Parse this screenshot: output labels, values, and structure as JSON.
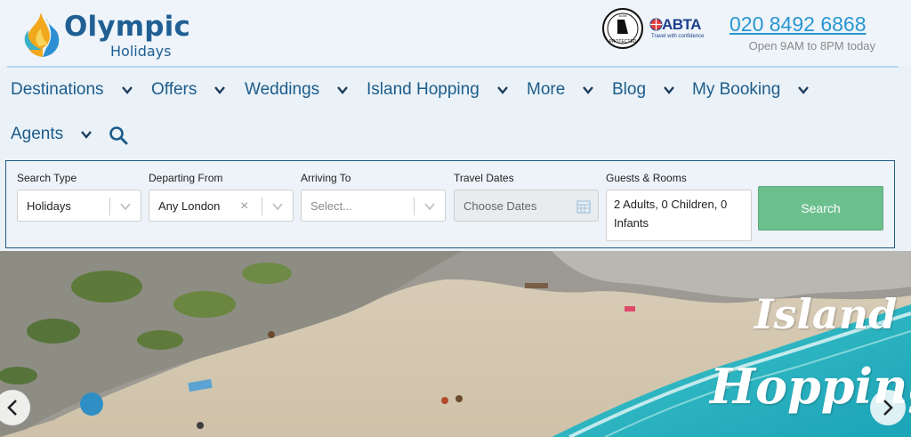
{
  "header": {
    "logo_name": "Olympic",
    "logo_sub": "Holidays",
    "atol_text": "PROTECTED",
    "atol_number": "6108",
    "abta_text": "ABTA",
    "abta_sub": "Travel with confidence",
    "phone": "020 8492 6868",
    "hours": "Open 9AM to 8PM today"
  },
  "nav": {
    "items": [
      {
        "label": "Destinations"
      },
      {
        "label": "Offers"
      },
      {
        "label": "Weddings"
      },
      {
        "label": "Island Hopping"
      },
      {
        "label": "More"
      },
      {
        "label": "Blog"
      },
      {
        "label": "My Booking"
      },
      {
        "label": "Agents"
      }
    ]
  },
  "search": {
    "search_type_label": "Search Type",
    "search_type_value": "Holidays",
    "departing_label": "Departing From",
    "departing_value": "Any London",
    "arriving_label": "Arriving To",
    "arriving_placeholder": "Select...",
    "dates_label": "Travel Dates",
    "dates_placeholder": "Choose Dates",
    "guests_label": "Guests & Rooms",
    "guests_value": "2 Adults, 0 Children, 0 Infants",
    "button_label": "Search"
  },
  "hero": {
    "line1": "Island",
    "line2": "Hopping"
  },
  "colors": {
    "brand_blue": "#1f5f94",
    "phone_blue": "#2996d2",
    "search_green": "#6cc08e",
    "panel_border": "#215c83"
  },
  "icons": [
    "logo-flame-icon",
    "chevron-down-icon",
    "search-icon",
    "clear-icon",
    "calendar-icon",
    "arrow-left-icon",
    "arrow-right-icon",
    "globe-icon"
  ]
}
